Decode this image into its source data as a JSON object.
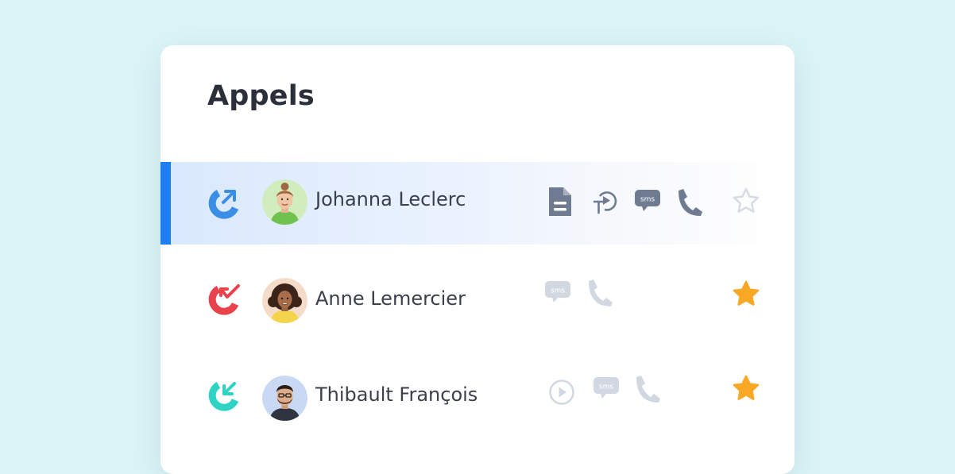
{
  "panel": {
    "title": "Appels"
  },
  "calls": [
    {
      "name": "Johanna Leclerc",
      "direction": "outgoing",
      "direction_color": "#3a8ee6",
      "selected": true,
      "favorite": false,
      "actions": [
        "document-icon",
        "transcript-play-icon",
        "sms-icon",
        "phone-icon"
      ],
      "sms_label": "sms"
    },
    {
      "name": "Anne Lemercier",
      "direction": "missed",
      "direction_color": "#e8424c",
      "selected": false,
      "favorite": true,
      "actions": [
        "sms-icon",
        "phone-icon"
      ],
      "sms_label": "sms"
    },
    {
      "name": "Thibault François",
      "direction": "incoming",
      "direction_color": "#2fd3c4",
      "selected": false,
      "favorite": true,
      "actions": [
        "play-icon",
        "sms-icon",
        "phone-icon"
      ],
      "sms_label": "sms"
    }
  ],
  "colors": {
    "background": "#dcf4f7",
    "accent": "#1e7df0",
    "active_icon": "#6f7b90",
    "inactive_icon": "#d2d8e1",
    "star_filled": "#f9a825",
    "star_outline": "#d7dce4"
  }
}
